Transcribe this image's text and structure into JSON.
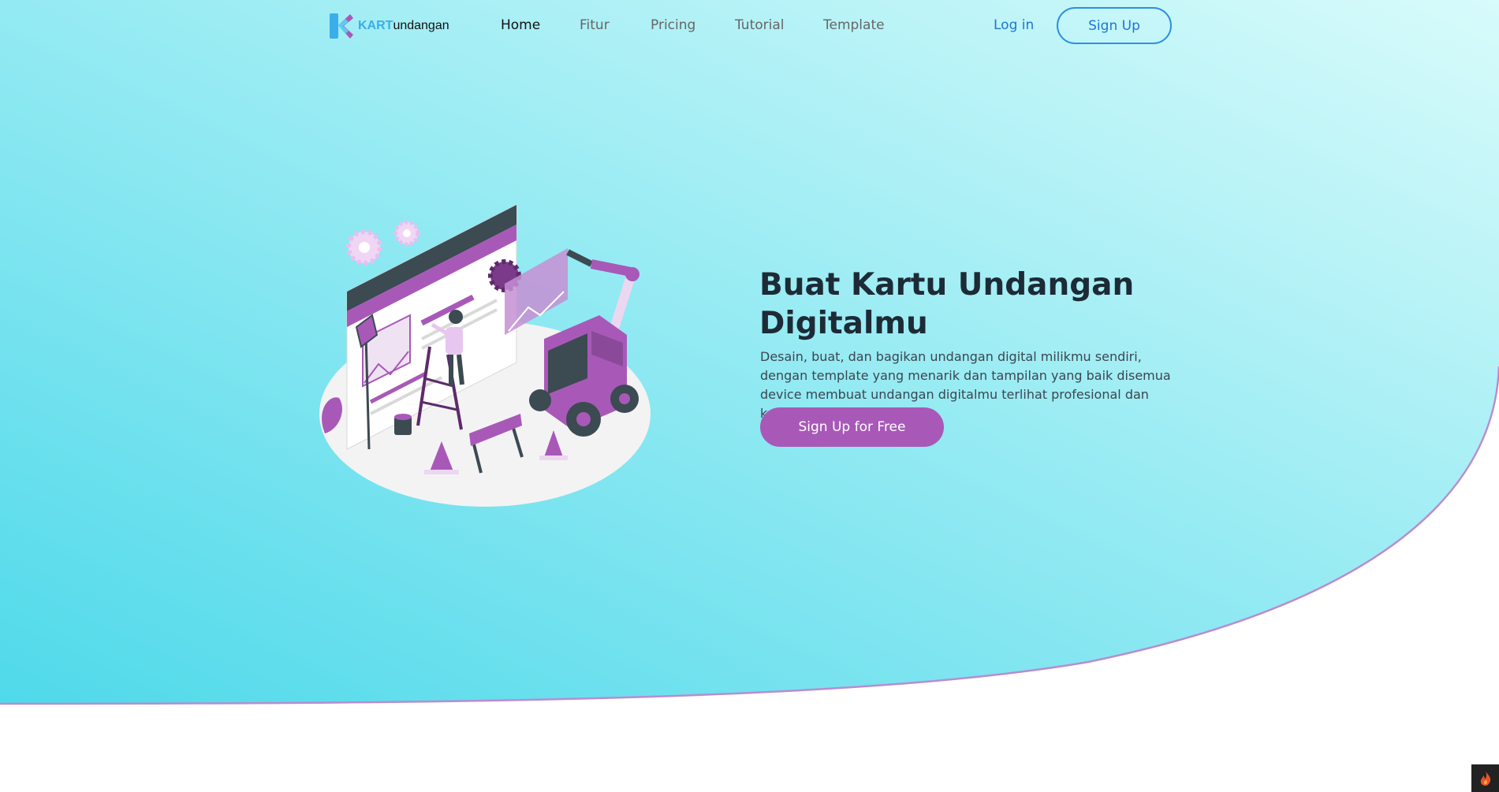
{
  "brand": {
    "name_accent": "KART",
    "name_rest": "undangan",
    "logo_icon": "k-logo-icon"
  },
  "nav": {
    "links": [
      {
        "label": "Home",
        "active": true
      },
      {
        "label": "Fitur",
        "active": false
      },
      {
        "label": "Pricing",
        "active": false
      },
      {
        "label": "Tutorial",
        "active": false
      },
      {
        "label": "Template",
        "active": false
      }
    ],
    "login_label": "Log in",
    "signup_label": "Sign Up"
  },
  "hero": {
    "title": "Buat Kartu Undangan Digitalmu",
    "description": "Desain, buat, dan bagikan undangan digital milikmu sendiri, dengan template yang menarik dan tampilan yang baik disemua device membuat undangan digitalmu terlihat profesional dan kekinian",
    "cta_label": "Sign Up for Free",
    "illustration_icon": "website-construction-illustration"
  },
  "colors": {
    "gradient_start": "#4fd9ea",
    "gradient_end": "#d8fbfb",
    "accent_purple": "#a859b8",
    "link_blue": "#1e74d8",
    "curve_border": "#b98cd0"
  },
  "corner_icon": "flame-icon"
}
